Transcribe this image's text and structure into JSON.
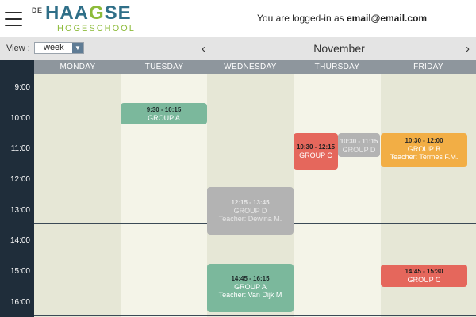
{
  "header": {
    "logo": {
      "prefix": "DE",
      "main_a": "HAA",
      "main_b": "G",
      "main_c": "SE",
      "sub": "HOGESCHOOL"
    },
    "login_prefix": "You are logged-in as ",
    "login_email": "email@email.com"
  },
  "toolbar": {
    "view_label": "View :",
    "view_value": "week",
    "prev": "‹",
    "next": "›",
    "month": "November"
  },
  "days": [
    "MONDAY",
    "TUESDAY",
    "WEDNESDAY",
    "THURSDAY",
    "FRIDAY"
  ],
  "times": [
    "9:00",
    "10:00",
    "11:00",
    "12:00",
    "13:00",
    "14:00",
    "15:00",
    "16:00"
  ],
  "events": [
    {
      "day": "TUESDAY",
      "time": "9:30 - 10:15",
      "group": "GROUP A",
      "teacher": "",
      "color": "#7bb89c"
    },
    {
      "day": "THURSDAY",
      "time": "10:30 - 12:15",
      "group": "GROUP C",
      "teacher": "",
      "color": "#e5675c"
    },
    {
      "day": "THURSDAY",
      "time": "10:30 - 11:15",
      "group": "GROUP D",
      "teacher": "",
      "color": "#b3b3b3"
    },
    {
      "day": "FRIDAY",
      "time": "10:30 - 12:00",
      "group": "GROUP B",
      "teacher": "Teacher: Termes F.M.",
      "color": "#f2ae45"
    },
    {
      "day": "WEDNESDAY",
      "time": "12:15 - 13:45",
      "group": "GROUP D",
      "teacher": "Teacher: Dewina M.",
      "color": "#b3b3b3"
    },
    {
      "day": "WEDNESDAY",
      "time": "14:45 - 16:15",
      "group": "GROUP A",
      "teacher": "Teacher: Van Dijk M",
      "color": "#7bb89c"
    },
    {
      "day": "FRIDAY",
      "time": "14:45 - 15:30",
      "group": "GROUP C",
      "teacher": "",
      "color": "#e5675c"
    }
  ],
  "colors": {
    "column_dark": "#e6e7d6",
    "column_light": "#f4f4e8",
    "sidebar": "#1f2d3a",
    "dayhead": "#8e969d"
  }
}
